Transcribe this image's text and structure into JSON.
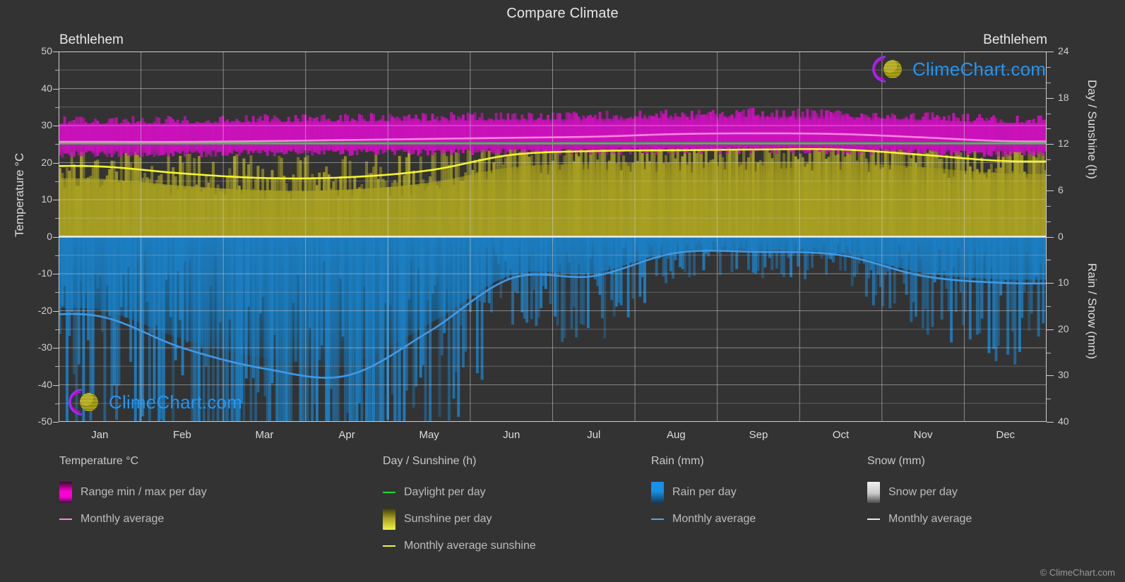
{
  "header": {
    "title": "Compare Climate",
    "location_left": "Bethlehem",
    "location_right": "Bethlehem"
  },
  "axes": {
    "left_label": "Temperature °C",
    "right_label_top": "Day / Sunshine (h)",
    "right_label_bottom": "Rain / Snow (mm)",
    "left_ticks": [
      "50",
      "40",
      "30",
      "20",
      "10",
      "0",
      "-10",
      "-20",
      "-30",
      "-40",
      "-50"
    ],
    "right_ticks_top": [
      "24",
      "18",
      "12",
      "6",
      "0"
    ],
    "right_ticks_bottom": [
      "0",
      "10",
      "20",
      "30",
      "40"
    ],
    "x_ticks": [
      "Jan",
      "Feb",
      "Mar",
      "Apr",
      "May",
      "Jun",
      "Jul",
      "Aug",
      "Sep",
      "Oct",
      "Nov",
      "Dec"
    ]
  },
  "watermark": {
    "text": "ClimeChart.com",
    "copyright": "© ClimeChart.com"
  },
  "legend": {
    "groups": [
      {
        "title": "Temperature °C",
        "items": [
          {
            "label": "Range min / max per day",
            "marker": "box",
            "color": "#ff00d4"
          },
          {
            "label": "Monthly average",
            "marker": "line",
            "color": "#ff82e0"
          }
        ]
      },
      {
        "title": "Day / Sunshine (h)",
        "items": [
          {
            "label": "Daylight per day",
            "marker": "line",
            "color": "#12e02a"
          },
          {
            "label": "Sunshine per day",
            "marker": "box",
            "color": "#f2f24a"
          },
          {
            "label": "Monthly average sunshine",
            "marker": "line",
            "color": "#f5f52e"
          }
        ]
      },
      {
        "title": "Rain (mm)",
        "items": [
          {
            "label": "Rain per day",
            "marker": "box",
            "color": "#1790e8"
          },
          {
            "label": "Monthly average",
            "marker": "line",
            "color": "#4aa8f0"
          }
        ]
      },
      {
        "title": "Snow (mm)",
        "items": [
          {
            "label": "Snow per day",
            "marker": "box",
            "color": "#e9e9e9"
          },
          {
            "label": "Monthly average",
            "marker": "line",
            "color": "#e9e9e9"
          }
        ]
      }
    ]
  },
  "colors": {
    "background": "#333333",
    "temp_band": "#cc11bb",
    "temp_avg": "#ff82e0",
    "daylight": "#12e02a",
    "sunshine_band": "#a8a022",
    "sunshine_avg": "#f5f52e",
    "rain_band": "#1c6fb0",
    "rain_avg": "#3d9ae8",
    "snow": "#dddddd",
    "grid": "#c8c8c8",
    "text": "#d9d9d9",
    "link": "#2196f3"
  },
  "chart_data": {
    "type": "area",
    "title": "Compare Climate",
    "subtitle": "Bethlehem",
    "xlabel": "",
    "ylabel": "Temperature °C",
    "ylim": [
      -50,
      50
    ],
    "y2lim_top": [
      0,
      24
    ],
    "y2lim_bottom": [
      0,
      40
    ],
    "grid": true,
    "legend_position": "bottom",
    "categories": [
      "Jan",
      "Feb",
      "Mar",
      "Apr",
      "May",
      "Jun",
      "Jul",
      "Aug",
      "Sep",
      "Oct",
      "Nov",
      "Dec"
    ],
    "series": [
      {
        "name": "Temperature daily maximum (band top)",
        "unit": "°C",
        "axis": "left",
        "values": [
          30.5,
          30.6,
          31.0,
          31.2,
          31.4,
          31.6,
          31.8,
          32.4,
          32.6,
          32.4,
          31.6,
          30.8
        ]
      },
      {
        "name": "Temperature daily minimum (band bottom)",
        "unit": "°C",
        "axis": "left",
        "values": [
          22.9,
          23.0,
          23.2,
          23.4,
          23.5,
          23.6,
          23.6,
          23.8,
          23.9,
          23.8,
          23.4,
          23.0
        ]
      },
      {
        "name": "Temperature monthly average",
        "unit": "°C",
        "axis": "left",
        "values": [
          25.6,
          25.6,
          25.8,
          26.1,
          26.4,
          26.7,
          27.0,
          27.7,
          27.9,
          27.7,
          26.8,
          25.8
        ]
      },
      {
        "name": "Daylight per day",
        "unit": "h",
        "axis": "right_top",
        "values": [
          12.1,
          12.1,
          12.1,
          12.1,
          12.1,
          12.1,
          12.1,
          12.1,
          12.1,
          12.1,
          12.1,
          12.1
        ]
      },
      {
        "name": "Monthly average sunshine",
        "unit": "h",
        "axis": "right_top",
        "values": [
          9.1,
          8.2,
          7.6,
          7.7,
          8.6,
          10.6,
          11.1,
          11.2,
          11.3,
          11.3,
          10.6,
          9.8
        ]
      },
      {
        "name": "Rain monthly average",
        "unit": "mm",
        "axis": "right_bottom",
        "values": [
          17.2,
          24.0,
          28.5,
          30.0,
          20.5,
          9.0,
          8.5,
          3.5,
          3.3,
          4.0,
          8.5,
          10.0
        ]
      },
      {
        "name": "Snow monthly average",
        "unit": "mm",
        "axis": "right_bottom",
        "values": [
          0,
          0,
          0,
          0,
          0,
          0,
          0,
          0,
          0,
          0,
          0,
          0
        ]
      }
    ]
  }
}
